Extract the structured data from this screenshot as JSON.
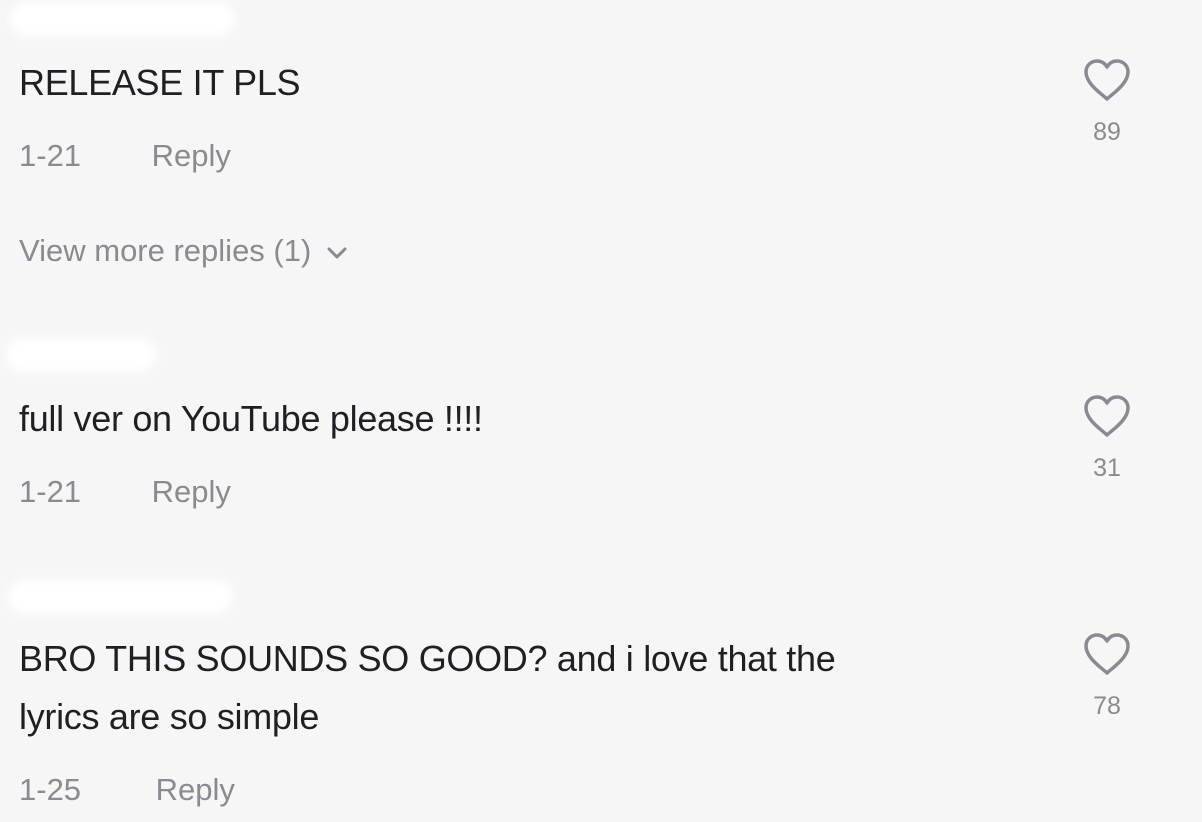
{
  "comments": [
    {
      "text": "RELEASE IT PLS",
      "date": "1-21",
      "reply_label": "Reply",
      "likes": "89",
      "view_more": "View more replies (1)"
    },
    {
      "text": "full ver on YouTube please !!!!",
      "date": "1-21",
      "reply_label": "Reply",
      "likes": "31"
    },
    {
      "text_line1": "BRO THIS SOUNDS SO GOOD? and i love that the",
      "text_line2": "lyrics are so simple",
      "date": "1-25",
      "reply_label": "Reply",
      "likes": "78"
    }
  ],
  "icons": {
    "like": "heart-outline-icon",
    "expand": "chevron-down-icon"
  },
  "colors": {
    "background": "#f6f6f6",
    "text": "#1f1f24",
    "secondary": "#8a8b91"
  }
}
